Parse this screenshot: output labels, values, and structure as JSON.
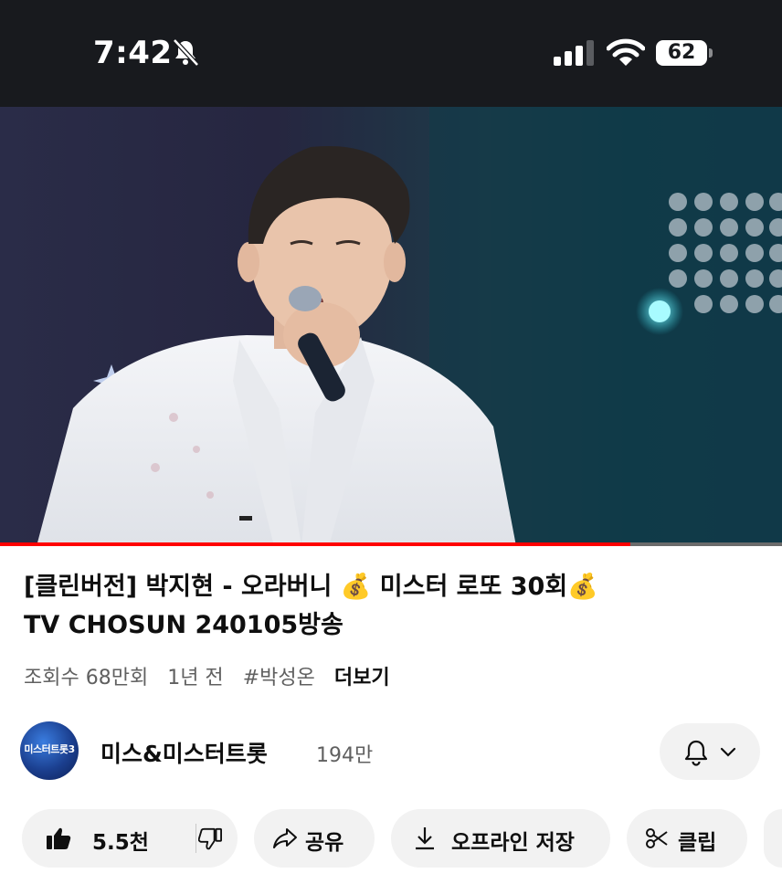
{
  "status_bar": {
    "time": "7:42",
    "battery": "62"
  },
  "player": {
    "progress_fraction": 0.806
  },
  "video": {
    "title_part1": "[클린버전] 박지현 - 오라버니 ",
    "emoji": "💰",
    "title_part2": " 미스터 로또 30회",
    "title_line2": "TV CHOSUN 240105방송",
    "views": "조회수 68만회",
    "age": "1년 전",
    "hashtag": "#박성온",
    "more": "더보기"
  },
  "channel": {
    "avatar_text": "미스터트롯3",
    "name": "미스&미스터트롯",
    "subscribers": "194만"
  },
  "actions": {
    "likes": "5.5천",
    "share": "공유",
    "download": "오프라인 저장",
    "clip": "클립"
  },
  "colors": {
    "accent": "#ff0000",
    "pill_bg": "#f2f2f2",
    "status_bg": "#181a1e"
  }
}
